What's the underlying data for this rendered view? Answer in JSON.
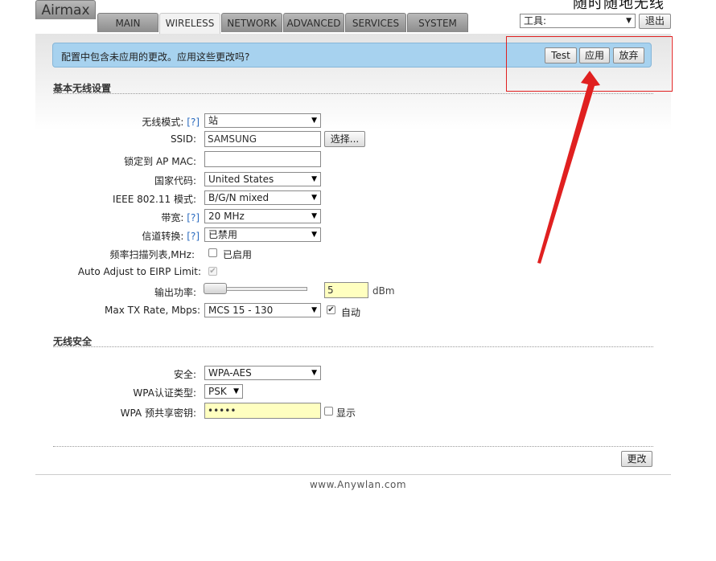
{
  "watermark": "随时随地无线",
  "tabs": [
    {
      "label": "Airmax",
      "active": false
    },
    {
      "label": "MAIN",
      "active": false
    },
    {
      "label": "WIRELESS",
      "active": true
    },
    {
      "label": "NETWORK",
      "active": false
    },
    {
      "label": "ADVANCED",
      "active": false
    },
    {
      "label": "SERVICES",
      "active": false
    },
    {
      "label": "SYSTEM",
      "active": false
    }
  ],
  "tools": {
    "select_value": "工具:",
    "logout_label": "退出"
  },
  "notice": {
    "text": "配置中包含未应用的更改。应用这些更改吗?",
    "test_label": "Test",
    "apply_label": "应用",
    "discard_label": "放弃"
  },
  "basic": {
    "title": "基本无线设置",
    "wireless_mode": {
      "label": "无线模式:",
      "help": "[?]",
      "value": "站"
    },
    "ssid": {
      "label": "SSID:",
      "value": "SAMSUNG",
      "select_label": "选择..."
    },
    "lock_ap": {
      "label": "锁定到 AP MAC:",
      "value": ""
    },
    "country": {
      "label": "国家代码:",
      "value": "United States"
    },
    "ieee_mode": {
      "label": "IEEE 802.11 模式:",
      "value": "B/G/N mixed"
    },
    "bandwidth": {
      "label": "带宽:",
      "help": "[?]",
      "value": "20 MHz"
    },
    "channel_shift": {
      "label": "信道转换:",
      "help": "[?]",
      "value": "已禁用"
    },
    "scan_list": {
      "label": "频率扫描列表,MHz:",
      "check_label": "已启用",
      "checked": false
    },
    "auto_eirp": {
      "label": "Auto Adjust to EIRP Limit:",
      "checked": true
    },
    "output_power": {
      "label": "输出功率:",
      "value": "5",
      "unit": "dBm"
    },
    "max_tx": {
      "label": "Max TX Rate, Mbps:",
      "value": "MCS 15 - 130",
      "auto_label": "自动",
      "auto_checked": true
    }
  },
  "security": {
    "title": "无线安全",
    "security": {
      "label": "安全:",
      "value": "WPA-AES"
    },
    "auth_type": {
      "label": "WPA认证类型:",
      "value": "PSK"
    },
    "psk": {
      "label": "WPA 预共享密钥:",
      "value": "•••••",
      "show_label": "显示"
    }
  },
  "change_label": "更改",
  "footer": "www.Anywlan.com",
  "colors": {
    "notice_bg": "#a7d2ef",
    "annotation": "#e02020",
    "field_yellow": "#ffffc0"
  }
}
